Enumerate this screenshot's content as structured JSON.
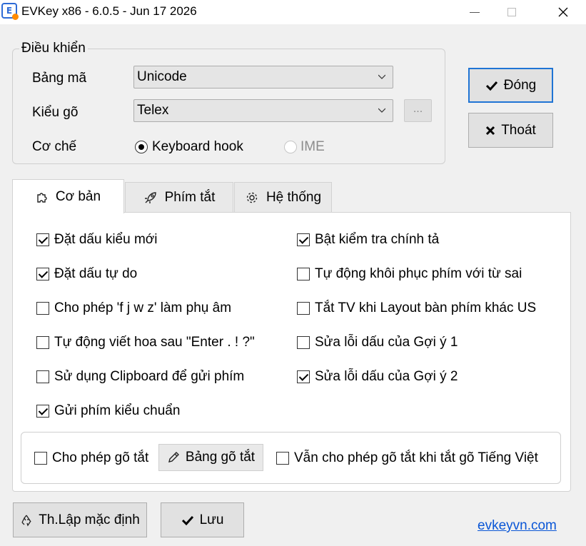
{
  "window": {
    "title": "EVKey x86 - 6.0.5 - Jun 17 2026",
    "icon_letter": "E"
  },
  "controls": {
    "legend": "Điều khiển",
    "charset_label": "Bảng mã",
    "charset_value": "Unicode",
    "input_method_label": "Kiểu gõ",
    "input_method_value": "Telex",
    "more_button": "...",
    "mechanism_label": "Cơ chế",
    "mode_options": [
      {
        "label": "Keyboard hook",
        "selected": true,
        "enabled": true
      },
      {
        "label": "IME",
        "selected": false,
        "enabled": false
      }
    ]
  },
  "actions": {
    "close_label": "Đóng",
    "exit_label": "Thoát"
  },
  "tabs": [
    {
      "label": "Cơ bản",
      "icon": "puzzle-icon",
      "active": true
    },
    {
      "label": "Phím tắt",
      "icon": "rocket-icon",
      "active": false
    },
    {
      "label": "Hệ thống",
      "icon": "gear-icon",
      "active": false
    }
  ],
  "options_left": [
    {
      "label": "Đặt dấu kiểu mới",
      "checked": true
    },
    {
      "label": "Đặt dấu tự do",
      "checked": true
    },
    {
      "label": "Cho phép 'f j w z' làm phụ âm",
      "checked": false
    },
    {
      "label": "Tự động viết hoa sau \"Enter . ! ?\"",
      "checked": false
    },
    {
      "label": "Sử dụng Clipboard để gửi phím",
      "checked": false
    },
    {
      "label": "Gửi phím kiểu chuẩn",
      "checked": true
    }
  ],
  "options_right": [
    {
      "label": "Bật kiểm tra chính tả",
      "checked": true
    },
    {
      "label": "Tự động khôi phục phím với từ sai",
      "checked": false
    },
    {
      "label": "Tắt TV khi Layout bàn phím khác US",
      "checked": false
    },
    {
      "label": "Sửa lỗi dấu của Gợi ý 1",
      "checked": false
    },
    {
      "label": "Sửa lỗi dấu của Gợi ý 2",
      "checked": true
    }
  ],
  "shortcuts": {
    "allow_label": "Cho phép gõ tắt",
    "allow_checked": false,
    "table_button": "Bảng gõ tắt",
    "allow_when_off_label": "Vẫn cho phép gõ tắt khi tắt gõ Tiếng Việt",
    "allow_when_off_checked": false
  },
  "footer": {
    "reset_label": "Th.Lập mặc định",
    "save_label": "Lưu",
    "website_link": "evkeyvn.com"
  },
  "colors": {
    "accent": "#1f74d4",
    "link": "#0a56d6",
    "window_bg": "#f0f0f0",
    "panel_bg": "#ffffff"
  }
}
